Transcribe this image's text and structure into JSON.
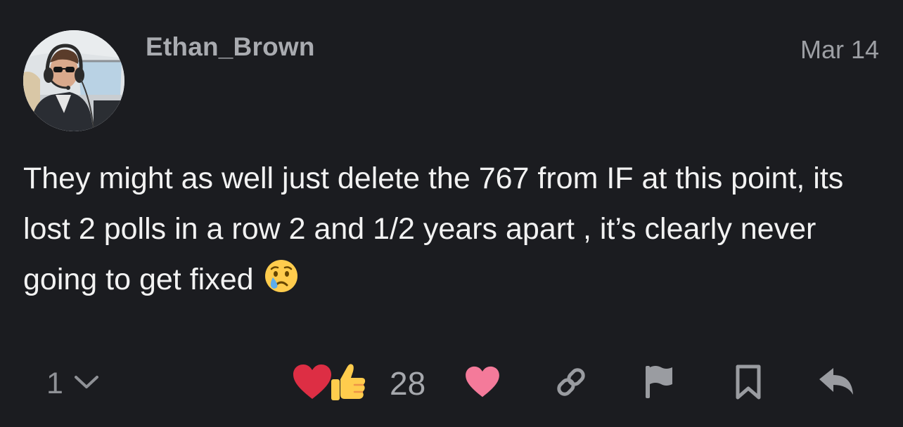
{
  "post": {
    "username": "Ethan_Brown",
    "date": "Mar 14",
    "body": "They might as well just delete the 767 from IF at this point, its lost 2 polls in a row 2 and 1/2 years apart , it’s clearly never going to get fixed",
    "body_emoji": "crying-face-emoji"
  },
  "actions": {
    "replies_count": "1",
    "reactions_count": "28",
    "icons": [
      "chevron-down-icon",
      "heart-emoji",
      "thumbs-up-emoji",
      "like-heart-icon",
      "link-icon",
      "flag-icon",
      "bookmark-icon",
      "reply-icon"
    ]
  },
  "colors": {
    "background": "#1b1c20",
    "username": "#a9abb0",
    "date": "#9d9fa4",
    "body_text": "#f2f2f2",
    "muted_icon": "#9a9ca1",
    "like_heart": "#f47a9a",
    "reaction_heart": "#dd2e44",
    "thumbs_up": "#ffcc4d"
  }
}
